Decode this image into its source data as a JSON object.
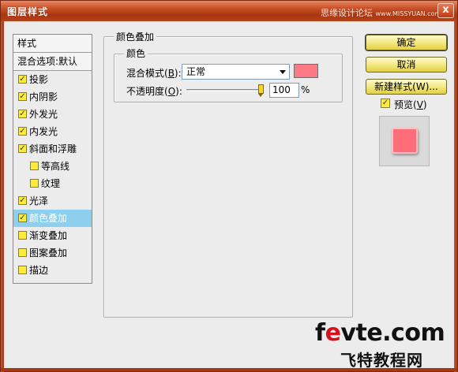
{
  "window": {
    "title": "图层样式",
    "watermark_text": "思缘设计论坛",
    "watermark_url": "www.MISSYUAN.com",
    "close_label": "x"
  },
  "sidebar": {
    "header": "样式",
    "blend_options": "混合选项:默认",
    "items": [
      {
        "label": "投影",
        "checked": true,
        "sub": false,
        "selected": false
      },
      {
        "label": "内阴影",
        "checked": true,
        "sub": false,
        "selected": false
      },
      {
        "label": "外发光",
        "checked": true,
        "sub": false,
        "selected": false
      },
      {
        "label": "内发光",
        "checked": true,
        "sub": false,
        "selected": false
      },
      {
        "label": "斜面和浮雕",
        "checked": true,
        "sub": false,
        "selected": false
      },
      {
        "label": "等高线",
        "checked": false,
        "sub": true,
        "selected": false
      },
      {
        "label": "纹理",
        "checked": false,
        "sub": true,
        "selected": false
      },
      {
        "label": "光泽",
        "checked": true,
        "sub": false,
        "selected": false
      },
      {
        "label": "颜色叠加",
        "checked": true,
        "sub": false,
        "selected": true
      },
      {
        "label": "渐变叠加",
        "checked": false,
        "sub": false,
        "selected": false
      },
      {
        "label": "图案叠加",
        "checked": false,
        "sub": false,
        "selected": false
      },
      {
        "label": "描边",
        "checked": false,
        "sub": false,
        "selected": false
      }
    ]
  },
  "panel": {
    "title": "颜色叠加",
    "color_group": "颜色",
    "blend_mode_label": "混合模式(",
    "blend_mode_key": "B",
    "blend_mode_suffix": "):",
    "blend_mode_value": "正常",
    "overlay_color": "#fb7a86",
    "opacity_label": "不透明度(",
    "opacity_key": "O",
    "opacity_suffix": "):",
    "opacity_value": "100",
    "opacity_fraction": 1.0,
    "opacity_unit": "%"
  },
  "buttons": {
    "ok": "确定",
    "cancel": "取消",
    "new_style": "新建样式(W)...",
    "preview_label": "预览(",
    "preview_key": "V",
    "preview_suffix": ")",
    "preview_checked": true
  },
  "preview": {
    "swatch_color": "#ff6d7b"
  },
  "site_watermark": {
    "domain_prefix": "f",
    "domain_e": "e",
    "domain_rest": "vte.com",
    "chinese": "飞特教程网"
  }
}
